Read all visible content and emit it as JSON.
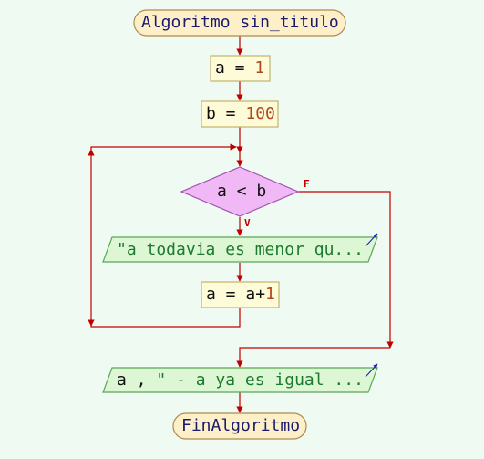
{
  "flowchart": {
    "start": {
      "kw": "Algoritmo",
      "name": "sin_titulo"
    },
    "assign_a": {
      "var": "a",
      "op": " = ",
      "val": "1"
    },
    "assign_b": {
      "var": "b",
      "op": " = ",
      "val": "100"
    },
    "loop_condition": {
      "a": "a",
      "op": " < ",
      "b": "b"
    },
    "branch_false": "F",
    "branch_true": "V",
    "output_in_loop": "\"a todavia es menor qu...",
    "increment": {
      "var": "a",
      "op": " = ",
      "expr_var": "a",
      "plus": "+",
      "val": "1"
    },
    "output_after_loop": {
      "var": "a",
      "sep": " , ",
      "str": "\" - a ya es igual ..."
    },
    "end": "FinAlgoritmo"
  },
  "colors": {
    "background": "#eefaf2",
    "terminal_fill": "#fdf0c8",
    "terminal_border": "#b08a4e",
    "process_fill": "#fefbd8",
    "process_border": "#c2b26a",
    "decision_fill": "#f1b8f6",
    "decision_border": "#a250b3",
    "io_fill": "#ddf6d4",
    "io_border": "#5aa858",
    "arrow": "#c00000",
    "io_marker": "#1a1ab0"
  }
}
